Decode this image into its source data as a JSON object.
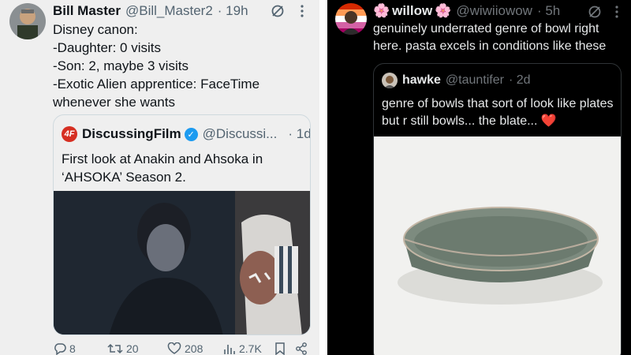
{
  "left_tweet": {
    "author_name": "Bill Master",
    "handle": "@Bill_Master2",
    "time": "· 19h",
    "text": "Disney canon:\n-Daughter: 0 visits\n-Son: 2, maybe 3 visits\n-Exotic Alien apprentice: FaceTime whenever she wants",
    "quote": {
      "logo_text": "4F",
      "author_name": "DiscussingFilm",
      "handle": "@Discussi...",
      "time": "· 1d",
      "text": "First look at Anakin and Ahsoka in ‘AHSOKA’ Season 2."
    },
    "actions": {
      "replies": "8",
      "reposts": "20",
      "likes": "208",
      "views": "2.7K"
    }
  },
  "right_tweet": {
    "author_emoji_left": "🌸",
    "author_name": "willow",
    "author_emoji_right": "🌸",
    "handle": "@wiwiiowow",
    "time": "· 5h",
    "text": "genuinely underrated genre of bowl right here. pasta excels in conditions like these",
    "quote": {
      "author_name": "hawke",
      "handle": "@tauntifer",
      "time": "· 2d",
      "text": "genre of bowls that sort of look like plates but r still bowls... the blate...",
      "heart": "❤️"
    }
  },
  "colors": {
    "left_bg": "#efefef",
    "right_bg": "#000000",
    "verified": "#1d9bf0",
    "df_red": "#d62f22",
    "heart": "#f91880",
    "bowl_green": "#6d7c6e"
  },
  "icons": [
    "grok-icon",
    "more-icon",
    "verified-badge-icon",
    "reply-icon",
    "repost-icon",
    "like-icon",
    "views-icon",
    "bookmark-icon",
    "share-icon"
  ]
}
